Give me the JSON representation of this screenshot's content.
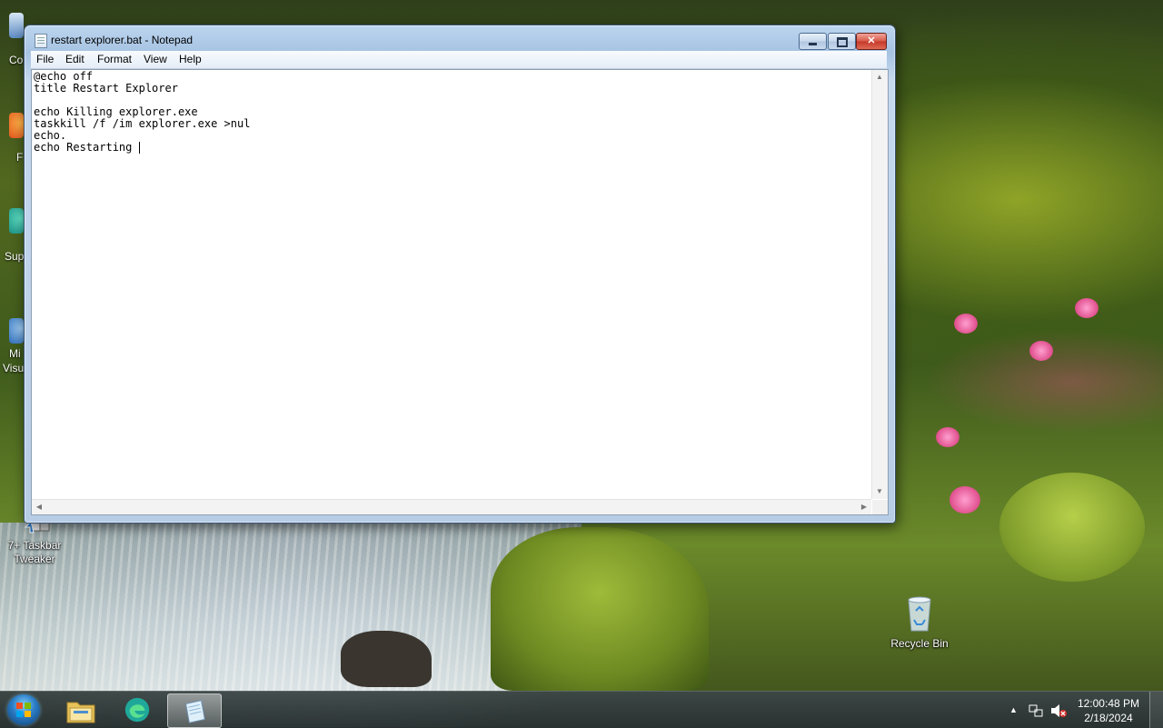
{
  "desktop": {
    "icons": [
      {
        "label_line1": "7+ Taskbar",
        "label_line2": "Tweaker"
      },
      {
        "label_line1": "Recycle Bin",
        "label_line2": ""
      }
    ],
    "left_stubs": [
      "Co",
      "F",
      "Sup",
      "Mi",
      "Visu"
    ]
  },
  "window": {
    "title": "restart explorer.bat - Notepad",
    "menu": [
      "File",
      "Edit",
      "Format",
      "View",
      "Help"
    ],
    "text_lines": [
      "@echo off",
      "title Restart Explorer",
      "",
      "echo Killing explorer.exe",
      "taskkill /f /im explorer.exe >nul",
      "echo.",
      "echo Restarting "
    ]
  },
  "taskbar": {
    "pinned": [
      "windows-explorer",
      "edge-browser",
      "notepad"
    ],
    "active": "notepad",
    "clock_time": "12:00:48 PM",
    "clock_date": "2/18/2024",
    "tray": [
      "show-hidden-icons",
      "network-icon",
      "volume-muted-icon"
    ]
  }
}
